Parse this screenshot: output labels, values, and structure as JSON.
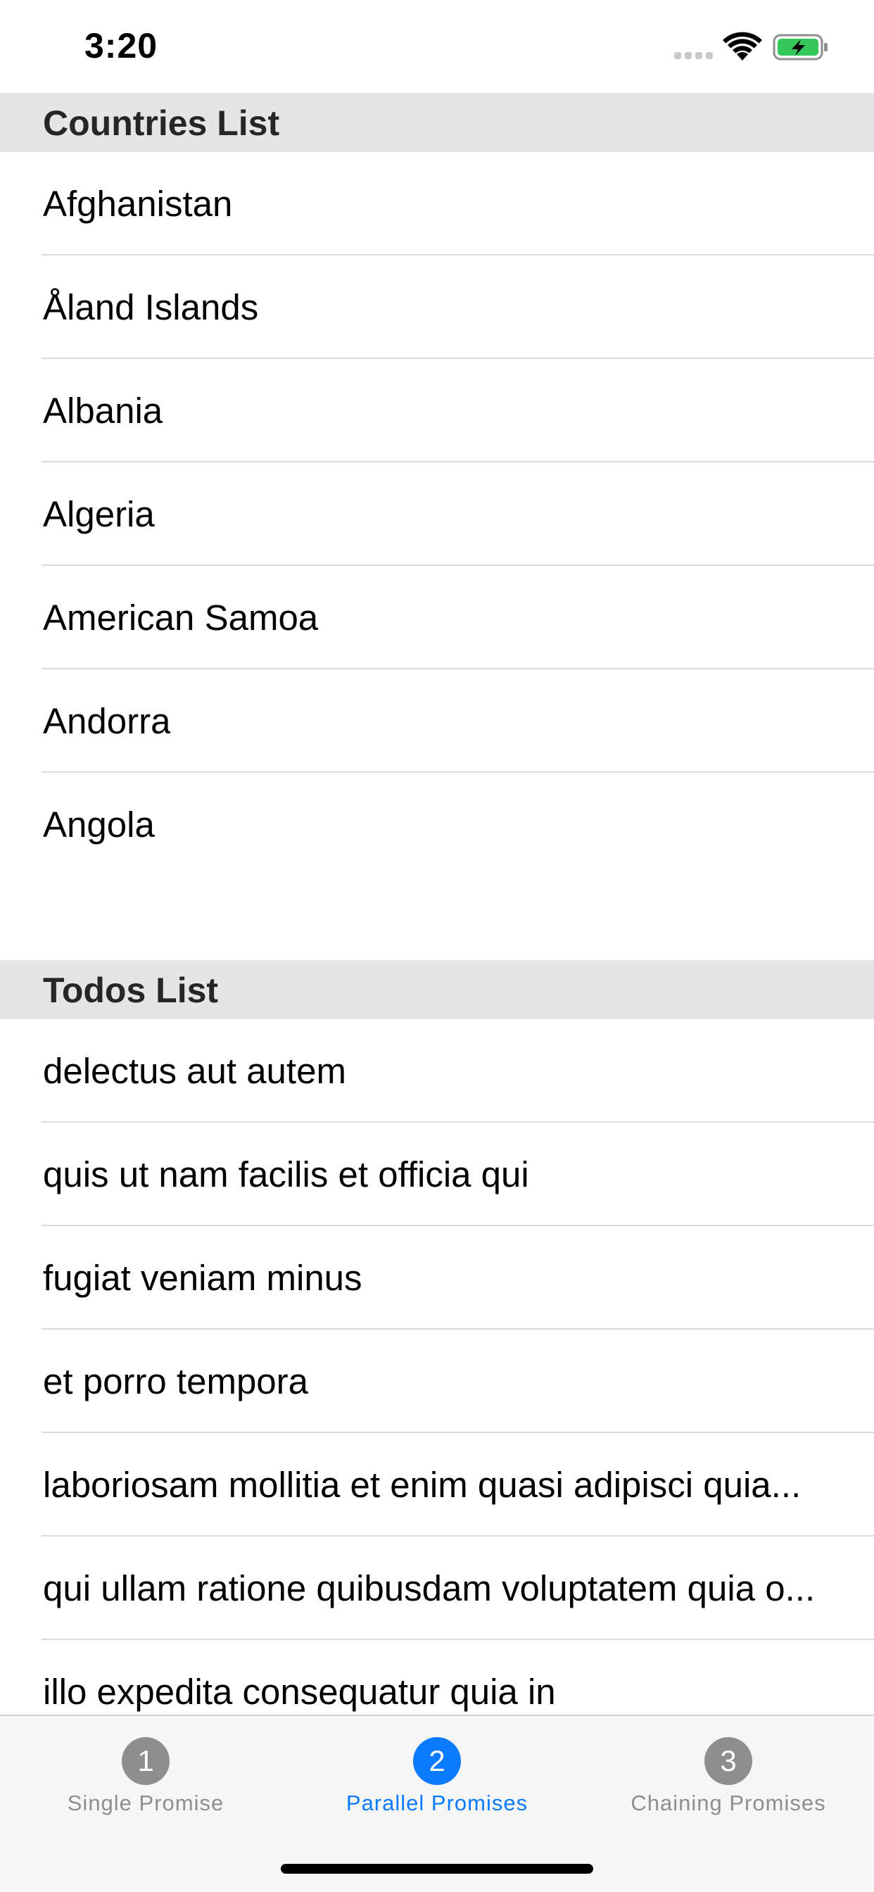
{
  "status_bar": {
    "time": "3:20",
    "icons": [
      "cellular-signal-icon",
      "wifi-icon",
      "battery-charging-icon"
    ],
    "battery_color": "#34c759"
  },
  "sections": {
    "countries": {
      "title": "Countries List",
      "items": [
        "Afghanistan",
        "Åland Islands",
        "Albania",
        "Algeria",
        "American Samoa",
        "Andorra",
        "Angola"
      ]
    },
    "todos": {
      "title": "Todos List",
      "items": [
        "delectus aut autem",
        "quis ut nam facilis et officia qui",
        "fugiat veniam minus",
        "et porro tempora",
        "laboriosam mollitia et enim quasi adipisci quia...",
        "qui ullam ratione quibusdam voluptatem quia o...",
        "illo expedita consequatur quia in"
      ]
    }
  },
  "tab_bar": {
    "active_color": "#0a7aff",
    "inactive_color": "#8e8e8e",
    "tabs": [
      {
        "badge": "1",
        "label": "Single Promise",
        "active": false
      },
      {
        "badge": "2",
        "label": "Parallel Promises",
        "active": true
      },
      {
        "badge": "3",
        "label": "Chaining Promises",
        "active": false
      }
    ]
  }
}
